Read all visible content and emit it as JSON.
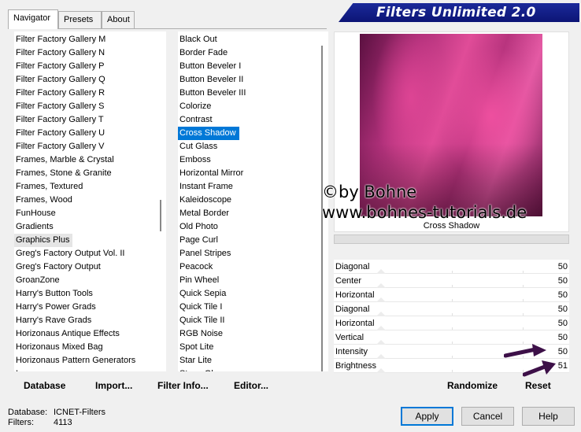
{
  "tabs": [
    {
      "label": "Navigator",
      "active": true
    },
    {
      "label": "Presets",
      "active": false
    },
    {
      "label": "About",
      "active": false
    }
  ],
  "app_title": "Filters Unlimited 2.0",
  "categories": [
    "Filter Factory Gallery M",
    "Filter Factory Gallery N",
    "Filter Factory Gallery P",
    "Filter Factory Gallery Q",
    "Filter Factory Gallery R",
    "Filter Factory Gallery S",
    "Filter Factory Gallery T",
    "Filter Factory Gallery U",
    "Filter Factory Gallery V",
    "Frames, Marble & Crystal",
    "Frames, Stone & Granite",
    "Frames, Textured",
    "Frames, Wood",
    "FunHouse",
    "Gradients",
    "Graphics Plus",
    "Greg's Factory Output Vol. II",
    "Greg's Factory Output",
    "GroanZone",
    "Harry's Button Tools",
    "Harry's Power Grads",
    "Harry's Rave Grads",
    "Horizonaus Antique Effects",
    "Horizonaus Mixed Bag",
    "Horizonaus Pattern Generators",
    "I..."
  ],
  "selected_category": "Graphics Plus",
  "filters": [
    "Black Out",
    "Border Fade",
    "Button Beveler I",
    "Button Beveler II",
    "Button Beveler III",
    "Colorize",
    "Contrast",
    "Cross Shadow",
    "Cut Glass",
    "Emboss",
    "Horizontal Mirror",
    "Instant Frame",
    "Kaleidoscope",
    "Metal Border",
    "Old Photo",
    "Page Curl",
    "Panel Stripes",
    "Peacock",
    "Pin Wheel",
    "Quick Sepia",
    "Quick Tile I",
    "Quick Tile II",
    "RGB Noise",
    "Spot Lite",
    "Star Lite",
    "Stone Glass"
  ],
  "selected_filter": "Cross Shadow",
  "preview": {
    "watermark_line1": "©by Bohne",
    "watermark_line2": "www.bohnes-tutorials.de",
    "filter_name": "Cross Shadow"
  },
  "params": [
    {
      "label": "Diagonal",
      "value": 50
    },
    {
      "label": "Center",
      "value": 50
    },
    {
      "label": "Horizontal",
      "value": 50
    },
    {
      "label": "Diagonal",
      "value": 50
    },
    {
      "label": "Horizontal",
      "value": 50
    },
    {
      "label": "Vertical",
      "value": 50
    },
    {
      "label": "Intensity",
      "value": 50
    },
    {
      "label": "Brightness",
      "value": 51
    }
  ],
  "left_buttons": {
    "database": "Database",
    "import": "Import...",
    "filter_info": "Filter Info...",
    "editor": "Editor..."
  },
  "right_buttons": {
    "randomize": "Randomize",
    "reset": "Reset"
  },
  "status": {
    "database_label": "Database:",
    "database_value": "ICNET-Filters",
    "filters_label": "Filters:",
    "filters_value": "4113"
  },
  "dialog_buttons": {
    "apply": "Apply",
    "cancel": "Cancel",
    "help": "Help"
  },
  "colors": {
    "selection": "#0078d7",
    "banner": "#0c1475",
    "arrow": "#3d1048"
  }
}
